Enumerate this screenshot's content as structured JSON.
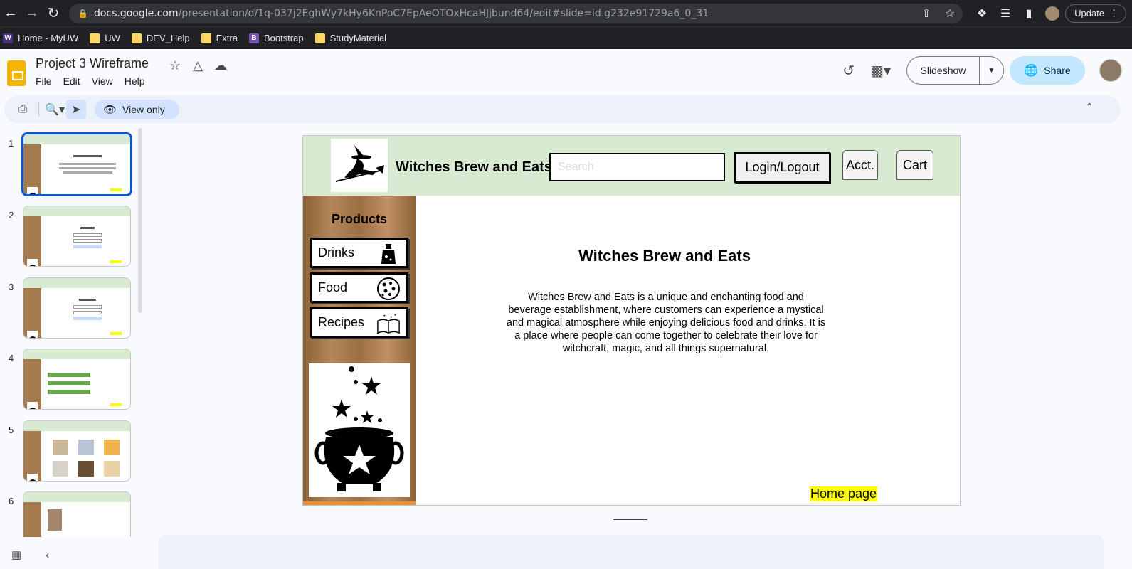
{
  "browser": {
    "url_host": "docs.google.com",
    "url_path": "/presentation/d/1q-037j2EghWy7kHy6KnPoC7EpAeOTOxHcaHJjbund64/edit#slide=id.g232e91729a6_0_31",
    "update_label": "Update"
  },
  "bookmarks": [
    {
      "label": "Home - MyUW",
      "icon": "W"
    },
    {
      "label": "UW"
    },
    {
      "label": "DEV_Help"
    },
    {
      "label": "Extra"
    },
    {
      "label": "Bootstrap",
      "icon": "B"
    },
    {
      "label": "StudyMaterial"
    }
  ],
  "app": {
    "doc_title": "Project 3 Wireframe",
    "menu": [
      "File",
      "Edit",
      "View",
      "Help"
    ],
    "slideshow_label": "Slideshow",
    "share_label": "Share",
    "view_only_label": "View only"
  },
  "filmstrip": {
    "slides": [
      "1",
      "2",
      "3",
      "4",
      "5",
      "6"
    ],
    "selected": "1"
  },
  "slide": {
    "brand": "Witches Brew and Eats",
    "search_placeholder": "Search",
    "login_label": "Login/Logout",
    "acct_label": "Acct.",
    "cart_label": "Cart",
    "products_heading": "Products",
    "categories": [
      "Drinks",
      "Food",
      "Recipes"
    ],
    "main_title": "Witches Brew and Eats",
    "main_description": "Witches Brew and Eats is a unique and enchanting food and beverage establishment, where customers can experience a mystical and magical atmosphere while enjoying delicious food and drinks. It is a place where people can come together to celebrate their love for witchcraft, magic, and all things supernatural.",
    "page_label": "Home page"
  }
}
